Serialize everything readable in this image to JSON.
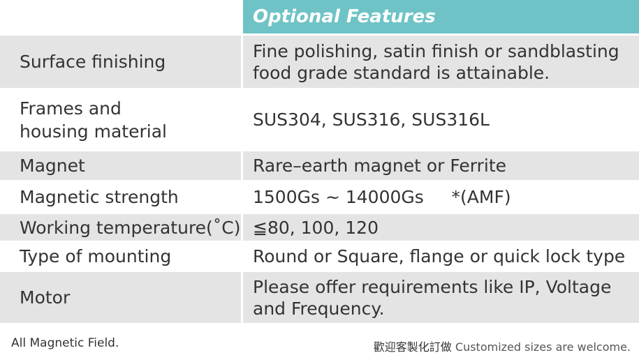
{
  "header": {
    "title": "Optional Features"
  },
  "rows": [
    {
      "label": "Surface finishing",
      "value": "Fine polishing, satin finish or sandblasting\nfood grade standard is attainable."
    },
    {
      "label": "Frames and\nhousing material",
      "value": "SUS304, SUS316, SUS316L"
    },
    {
      "label": "Magnet",
      "value": "Rare–earth magnet or Ferrite"
    },
    {
      "label": "Magnetic strength",
      "value": "1500Gs ~ 14000Gs     *(AMF)"
    },
    {
      "label": "Working temperature(˚C)",
      "value": "≦80, 100, 120"
    },
    {
      "label": "Type of mounting",
      "value": "Round or Square, flange or quick lock type"
    },
    {
      "label": "Motor",
      "value": "Please offer requirements like IP, Voltage\nand Frequency."
    }
  ],
  "footer": {
    "note": "All Magnetic Field.",
    "custom_cn": "歡迎客製化訂做",
    "custom_en": "Customized sizes are welcome."
  }
}
